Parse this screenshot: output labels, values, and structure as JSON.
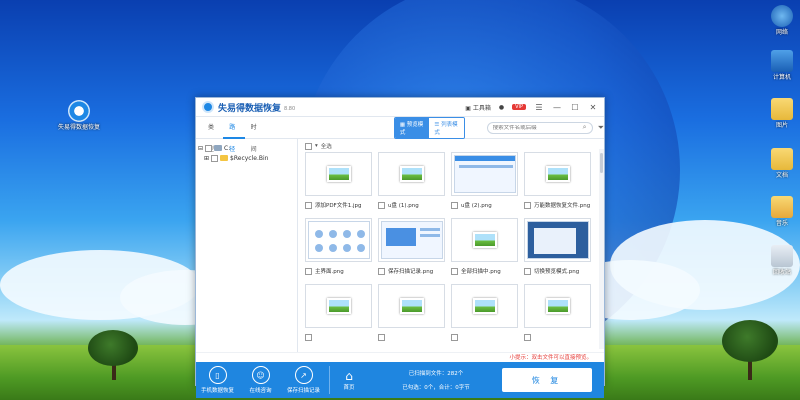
{
  "desktop": {
    "icons_left": [
      {
        "label": "失易得数据恢复",
        "icon": "app-icon"
      }
    ],
    "icons_right": [
      {
        "label": "网络",
        "icon": "network-icon"
      },
      {
        "label": "计算机",
        "icon": "computer-icon"
      },
      {
        "label": "图片",
        "icon": "folder-icon"
      },
      {
        "label": "文档",
        "icon": "folder-icon"
      },
      {
        "label": "音乐",
        "icon": "music-icon"
      },
      {
        "label": "回收站",
        "icon": "trash-icon"
      }
    ]
  },
  "window": {
    "title": "失易得数据恢复",
    "version": "8.80",
    "toolbox_label": "工具箱",
    "vip_label": "VIP",
    "tabs": [
      "类型",
      "路径",
      "时间"
    ],
    "modes": [
      "预览模式",
      "列表模式"
    ],
    "search_placeholder": "搜索文件名或后缀",
    "tree": [
      {
        "label": "C:",
        "icon": "drive-icon"
      },
      {
        "label": "$Recycle.Bin",
        "icon": "folder-icon"
      }
    ],
    "select_all": "全选",
    "files": [
      {
        "name": "添加PDF文件1.jpg",
        "kind": "image"
      },
      {
        "name": "u盘 (1).png",
        "kind": "image"
      },
      {
        "name": "u盘 (2).png",
        "kind": "screenshot"
      },
      {
        "name": "万能数据恢复文件.png",
        "kind": "image"
      },
      {
        "name": "主界面.png",
        "kind": "screenshot"
      },
      {
        "name": "保存扫描记录.png",
        "kind": "screenshot"
      },
      {
        "name": "全部扫描中.png",
        "kind": "image"
      },
      {
        "name": "切换预览模式.png",
        "kind": "screenshot"
      },
      {
        "name": "",
        "kind": "image"
      },
      {
        "name": "",
        "kind": "image"
      },
      {
        "name": "",
        "kind": "image"
      },
      {
        "name": "",
        "kind": "image"
      }
    ],
    "tip": "小提示：双击文件可以直接预览。",
    "footer": {
      "buttons": [
        {
          "label": "手机数据恢复",
          "icon": "phone-icon"
        },
        {
          "label": "在线咨询",
          "icon": "user-icon"
        },
        {
          "label": "保存扫描记录",
          "icon": "export-icon"
        }
      ],
      "home_label": "首页",
      "scanned_label": "已扫描到文件：282个",
      "selected_label": "已勾选：0个，合计：0字节",
      "recover_label": "恢 复"
    }
  }
}
